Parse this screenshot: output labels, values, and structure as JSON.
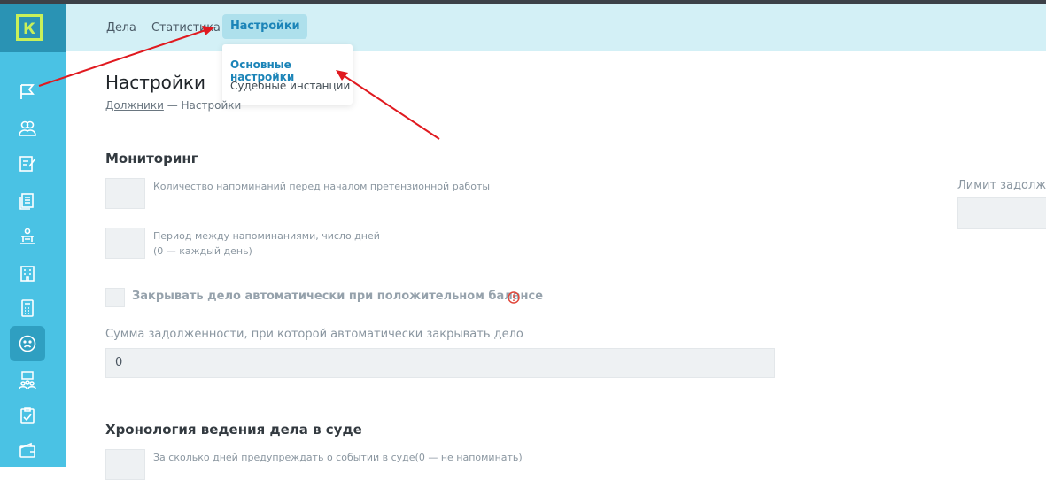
{
  "sidebar": {
    "logo_letter": "К",
    "items": [
      {
        "icon": "flag-icon"
      },
      {
        "icon": "users-icon"
      },
      {
        "icon": "edit-document-icon"
      },
      {
        "icon": "documents-icon"
      },
      {
        "icon": "court-icon"
      },
      {
        "icon": "building-icon"
      },
      {
        "icon": "calculator-icon"
      },
      {
        "icon": "sad-face-icon",
        "active": true
      },
      {
        "icon": "group-icon"
      },
      {
        "icon": "clipboard-check-icon"
      },
      {
        "icon": "wallet-icon"
      }
    ]
  },
  "nav": {
    "cases": "Дела",
    "statistics": "Статистика",
    "settings": "Настройки"
  },
  "dropdown": {
    "basic": "Основные настройки",
    "court": "Судебные инстанции"
  },
  "page": {
    "title": "Настройки",
    "breadcrumb_link": "Должники",
    "breadcrumb_sep": " — ",
    "breadcrumb_current": "Настройки"
  },
  "monitoring": {
    "title": "Мониторинг",
    "reminders_label": "Количество напоминаний перед началом претензионной работы",
    "period_label_1": "Период между напоминаниями, число дней",
    "period_label_2": "(0 — каждый день)",
    "auto_close_label": "Закрывать дело автоматически при положительном балансе",
    "sum_label": "Сумма задолженности, при которой автоматически закрывать дело",
    "sum_value": "0",
    "limit_label": "Лимит задолженности"
  },
  "court": {
    "title": "Хронология ведения дела в суде",
    "notify_label": "За сколько дней предупреждать о событии в суде(0 — не напоминать)"
  },
  "colors": {
    "sidebar": "#4ac2e4",
    "logo_bg": "#2a93b4",
    "accent": "#1b84b8",
    "arrow": "#e0191f"
  }
}
